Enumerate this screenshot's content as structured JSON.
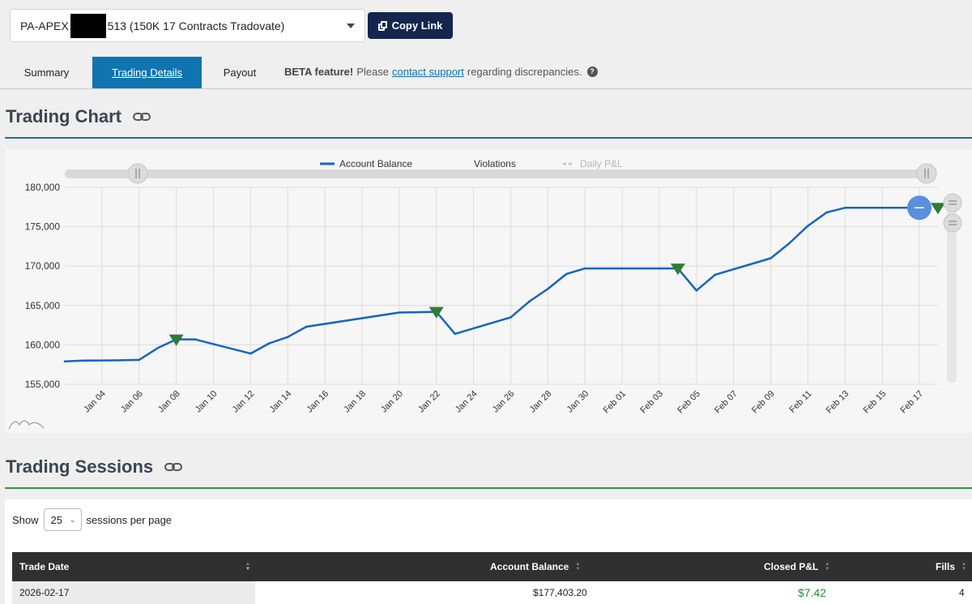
{
  "account": {
    "prefix": "PA-APEX",
    "suffix": "513 (150K 17 Contracts Tradovate)"
  },
  "copy_link_label": "Copy Link",
  "tabs": [
    {
      "label": "Summary",
      "active": false
    },
    {
      "label": "Trading Details",
      "active": true
    },
    {
      "label": "Payout",
      "active": false
    }
  ],
  "beta": {
    "bold": "BETA feature!",
    "pre": "Please",
    "link": "contact support",
    "post": "regarding discrepancies.",
    "help": "?"
  },
  "trading_chart_title": "Trading Chart",
  "trading_sessions_title": "Trading Sessions",
  "colors": {
    "accent": "#0f74b0",
    "dark_button": "#14264f",
    "balance_line": "#1565c0",
    "violation": "#2e7d32",
    "pnl_positive": "#2a8c2a",
    "section_rule_blue": "#1f6f96",
    "section_rule_green": "#2d9a3c"
  },
  "chart_data": {
    "type": "line",
    "legend": [
      {
        "name": "Account Balance",
        "style": "solid",
        "color": "#1565c0"
      },
      {
        "name": "Violations",
        "style": "marker",
        "color": "#2e7d32"
      },
      {
        "name": "Daily P&L",
        "style": "dashed",
        "color": "#cccccc",
        "hidden": true
      }
    ],
    "legend_position": "top-center",
    "x_ticks": [
      "Jan 04",
      "Jan 06",
      "Jan 08",
      "Jan 10",
      "Jan 12",
      "Jan 14",
      "Jan 16",
      "Jan 18",
      "Jan 20",
      "Jan 22",
      "Jan 24",
      "Jan 26",
      "Jan 28",
      "Jan 30",
      "Feb 01",
      "Feb 03",
      "Feb 05",
      "Feb 07",
      "Feb 09",
      "Feb 11",
      "Feb 13",
      "Feb 15",
      "Feb 17"
    ],
    "y_ticks": [
      "180,000",
      "175,000",
      "170,000",
      "165,000",
      "160,000",
      "155,000"
    ],
    "ylim": [
      155000,
      180000
    ],
    "grid": true,
    "series": [
      {
        "name": "Account Balance",
        "points": [
          {
            "x": "2026-01-02",
            "y": 157900
          },
          {
            "x": "2026-01-03",
            "y": 158000
          },
          {
            "x": "2026-01-05",
            "y": 158050
          },
          {
            "x": "2026-01-06",
            "y": 158100
          },
          {
            "x": "2026-01-07",
            "y": 159600
          },
          {
            "x": "2026-01-08",
            "y": 160700
          },
          {
            "x": "2026-01-09",
            "y": 160700
          },
          {
            "x": "2026-01-12",
            "y": 158900
          },
          {
            "x": "2026-01-13",
            "y": 160200
          },
          {
            "x": "2026-01-14",
            "y": 161000
          },
          {
            "x": "2026-01-15",
            "y": 162300
          },
          {
            "x": "2026-01-20",
            "y": 164100
          },
          {
            "x": "2026-01-22",
            "y": 164200
          },
          {
            "x": "2026-01-23",
            "y": 161400
          },
          {
            "x": "2026-01-26",
            "y": 163500
          },
          {
            "x": "2026-01-27",
            "y": 165500
          },
          {
            "x": "2026-01-28",
            "y": 167100
          },
          {
            "x": "2026-01-29",
            "y": 169000
          },
          {
            "x": "2026-01-30",
            "y": 169700
          },
          {
            "x": "2026-02-04",
            "y": 169700
          },
          {
            "x": "2026-02-05",
            "y": 166900
          },
          {
            "x": "2026-02-06",
            "y": 168900
          },
          {
            "x": "2026-02-09",
            "y": 171000
          },
          {
            "x": "2026-02-10",
            "y": 172900
          },
          {
            "x": "2026-02-11",
            "y": 175100
          },
          {
            "x": "2026-02-12",
            "y": 176800
          },
          {
            "x": "2026-02-13",
            "y": 177400
          },
          {
            "x": "2026-02-17",
            "y": 177400
          }
        ]
      },
      {
        "name": "Violations",
        "points": [
          {
            "x": "2026-01-08",
            "y": 160700
          },
          {
            "x": "2026-01-22",
            "y": 164200
          },
          {
            "x": "2026-02-04",
            "y": 169700
          },
          {
            "x": "2026-02-18",
            "y": 177400
          }
        ]
      }
    ]
  },
  "sessions": {
    "show_label": "Show",
    "per_page_value": "25",
    "per_page_suffix": "sessions per page",
    "columns": [
      "Trade Date",
      "Account Balance",
      "Closed P&L",
      "Fills"
    ],
    "rows": [
      {
        "trade_date": "2026-02-17",
        "account_balance": "$177,403.20",
        "closed_pnl": "$7.42",
        "fills": "4"
      }
    ]
  }
}
